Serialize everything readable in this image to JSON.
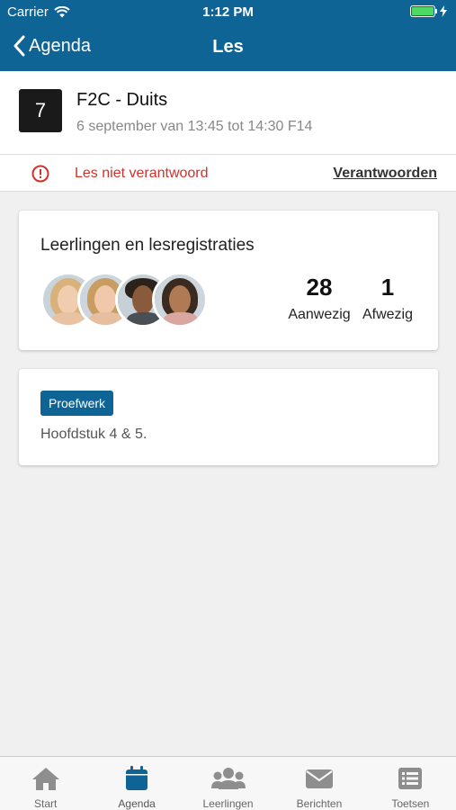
{
  "status_bar": {
    "carrier": "Carrier",
    "time": "1:12 PM"
  },
  "nav": {
    "back_label": "Agenda",
    "title": "Les"
  },
  "lesson": {
    "period": "7",
    "name": "F2C - Duits",
    "schedule": "6 september van 13:45 tot 14:30 F14"
  },
  "alert": {
    "message": "Les niet verantwoord",
    "action_label": "Verantwoorden"
  },
  "attendance_card": {
    "heading": "Leerlingen en lesregistraties",
    "present_count": "28",
    "present_label": "Aanwezig",
    "absent_count": "1",
    "absent_label": "Afwezig"
  },
  "assignment_card": {
    "tag": "Proefwerk",
    "description": "Hoofdstuk 4 & 5."
  },
  "tabs": [
    {
      "label": "Start",
      "icon": "home-icon"
    },
    {
      "label": "Agenda",
      "icon": "calendar-icon"
    },
    {
      "label": "Leerlingen",
      "icon": "users-icon"
    },
    {
      "label": "Berichten",
      "icon": "envelope-icon"
    },
    {
      "label": "Toetsen",
      "icon": "list-icon"
    }
  ],
  "colors": {
    "brand": "#0f6496",
    "alert": "#d0312d",
    "active_tab": "#0f6496",
    "inactive_tab": "#8e8e8e"
  }
}
